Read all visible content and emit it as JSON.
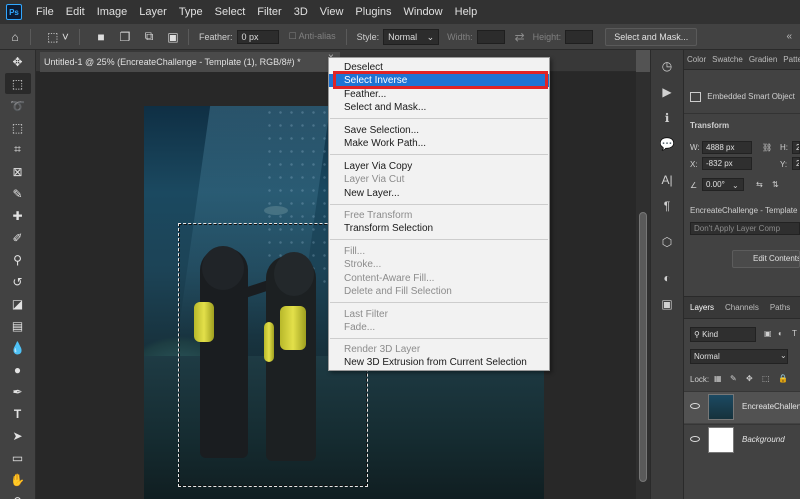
{
  "app": {
    "logo": "Ps"
  },
  "menubar": {
    "items": [
      "File",
      "Edit",
      "Image",
      "Layer",
      "Type",
      "Select",
      "Filter",
      "3D",
      "View",
      "Plugins",
      "Window",
      "Help"
    ]
  },
  "options": {
    "feather_label": "Feather:",
    "feather_value": "0 px",
    "antialias_label": "Anti-alias",
    "style_label": "Style:",
    "style_value": "Normal",
    "width_label": "Width:",
    "height_label": "Height:",
    "select_mask_button": "Select and Mask..."
  },
  "document": {
    "tab_title": "Untitled-1 @ 25% (EncreateChallenge - Template (1), RGB/8#) *",
    "close": "×"
  },
  "context_menu": {
    "groups": [
      [
        {
          "label": "Deselect",
          "disabled": false
        },
        {
          "label": "Select Inverse",
          "disabled": false,
          "highlighted": true
        },
        {
          "label": "Feather...",
          "disabled": false
        },
        {
          "label": "Select and Mask...",
          "disabled": false
        }
      ],
      [
        {
          "label": "Save Selection...",
          "disabled": false
        },
        {
          "label": "Make Work Path...",
          "disabled": false
        }
      ],
      [
        {
          "label": "Layer Via Copy",
          "disabled": false
        },
        {
          "label": "Layer Via Cut",
          "disabled": true
        },
        {
          "label": "New Layer...",
          "disabled": false
        }
      ],
      [
        {
          "label": "Free Transform",
          "disabled": true
        },
        {
          "label": "Transform Selection",
          "disabled": false
        }
      ],
      [
        {
          "label": "Fill...",
          "disabled": true
        },
        {
          "label": "Stroke...",
          "disabled": true
        },
        {
          "label": "Content-Aware Fill...",
          "disabled": true
        },
        {
          "label": "Delete and Fill Selection",
          "disabled": true
        }
      ],
      [
        {
          "label": "Last Filter",
          "disabled": true
        },
        {
          "label": "Fade...",
          "disabled": true
        }
      ],
      [
        {
          "label": "Render 3D Layer",
          "disabled": true
        },
        {
          "label": "New 3D Extrusion from Current Selection",
          "disabled": false
        }
      ]
    ]
  },
  "properties": {
    "tabs": [
      "Color",
      "Swatche",
      "Gradien",
      "Patte"
    ],
    "object_type": "Embedded Smart Object",
    "transform_label": "Transform",
    "w_label": "W:",
    "w_value": "4888 px",
    "x_label": "X:",
    "x_value": "-832 px",
    "h_label": "H:",
    "h_value": "2",
    "y_label": "Y:",
    "y_value": "2",
    "angle_value": "0.00°",
    "source_name": "EncreateChallenge - Template (",
    "layer_comp": "Don't Apply Layer Comp",
    "edit_contents": "Edit Contents"
  },
  "layers": {
    "tabs": [
      "Layers",
      "Channels",
      "Paths"
    ],
    "kind_label": "Kind",
    "blend_mode": "Normal",
    "lock_label": "Lock:",
    "items": [
      {
        "name": "EncreateChallen",
        "italic": false
      },
      {
        "name": "Background",
        "italic": true
      }
    ]
  },
  "colors": {
    "highlight": "#1e73d4",
    "annotation": "#e02326",
    "panel": "#424242"
  }
}
